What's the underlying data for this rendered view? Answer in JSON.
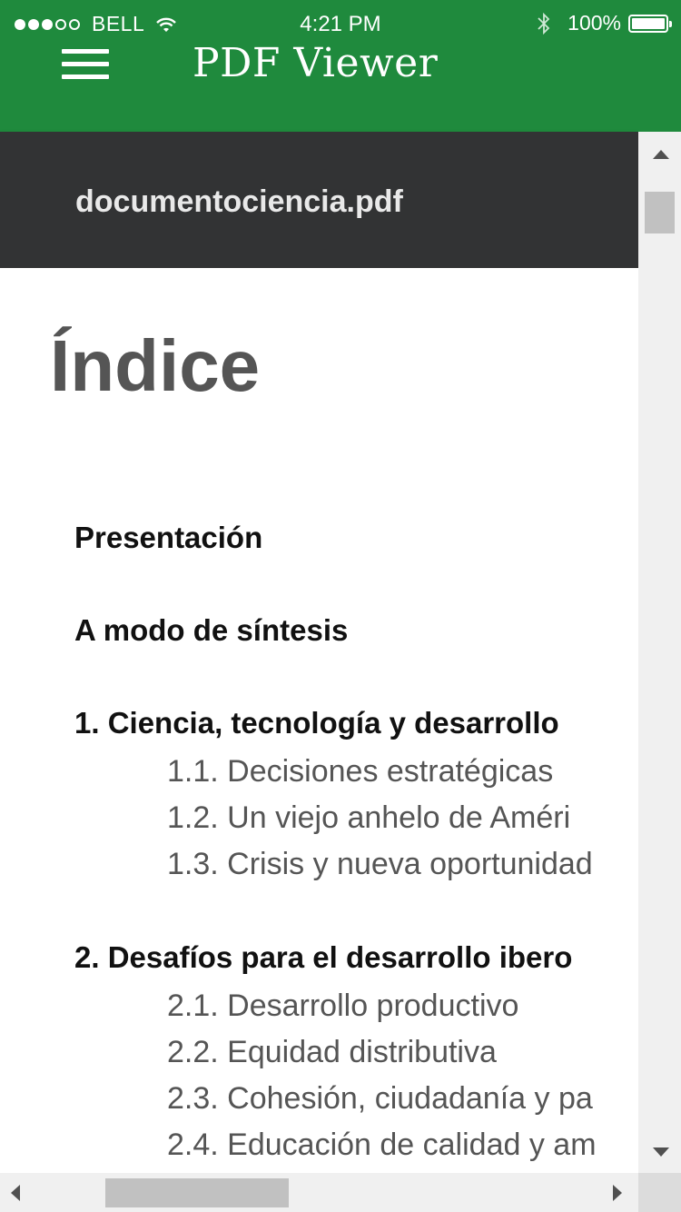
{
  "status_bar": {
    "carrier": "BELL",
    "time": "4:21 PM",
    "battery_percent": "100%"
  },
  "app_bar": {
    "title": "PDF Viewer"
  },
  "document": {
    "file_name": "documentociencia.pdf",
    "heading": "Índice",
    "toc": [
      {
        "text": "Presentación",
        "level": 1
      },
      {
        "text": "A modo de síntesis",
        "level": 1
      },
      {
        "text": "1. Ciencia, tecnología y desarrollo",
        "level": 1
      },
      {
        "text": "1.1. Decisiones estratégicas",
        "level": 2
      },
      {
        "text": "1.2. Un viejo anhelo de Améri",
        "level": 2
      },
      {
        "text": "1.3. Crisis y nueva oportunidad",
        "level": 2
      },
      {
        "text": "2. Desafíos para el desarrollo ibero",
        "level": 1
      },
      {
        "text": "2.1. Desarrollo productivo",
        "level": 2
      },
      {
        "text": "2.2. Equidad distributiva",
        "level": 2
      },
      {
        "text": "2.3. Cohesión, ciudadanía y pa",
        "level": 2
      },
      {
        "text": "2.4. Educación de calidad y am",
        "level": 2
      }
    ]
  },
  "colors": {
    "app_bar": "#1f8a3d",
    "doc_bar": "#323334",
    "heading": "#555555"
  }
}
